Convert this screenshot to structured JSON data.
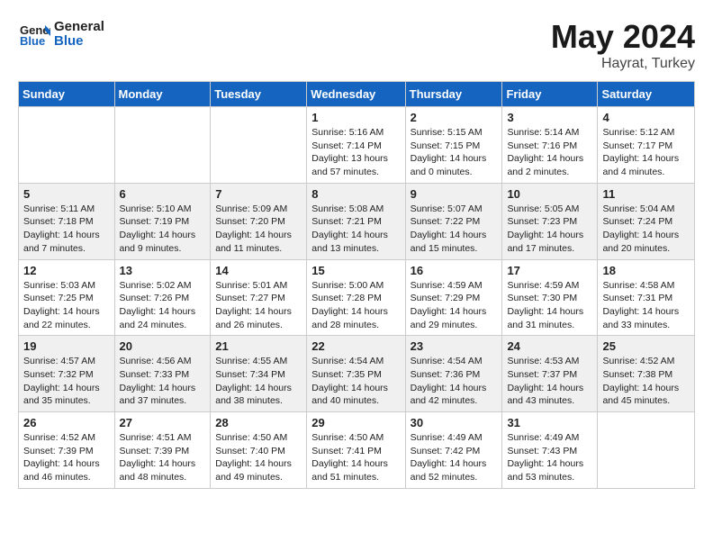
{
  "header": {
    "logo_text_general": "General",
    "logo_text_blue": "Blue",
    "title": "May 2024",
    "subtitle": "Hayrat, Turkey"
  },
  "weekdays": [
    "Sunday",
    "Monday",
    "Tuesday",
    "Wednesday",
    "Thursday",
    "Friday",
    "Saturday"
  ],
  "weeks": [
    [
      {
        "day": "",
        "info": ""
      },
      {
        "day": "",
        "info": ""
      },
      {
        "day": "",
        "info": ""
      },
      {
        "day": "1",
        "info": "Sunrise: 5:16 AM\nSunset: 7:14 PM\nDaylight: 13 hours and 57 minutes."
      },
      {
        "day": "2",
        "info": "Sunrise: 5:15 AM\nSunset: 7:15 PM\nDaylight: 14 hours and 0 minutes."
      },
      {
        "day": "3",
        "info": "Sunrise: 5:14 AM\nSunset: 7:16 PM\nDaylight: 14 hours and 2 minutes."
      },
      {
        "day": "4",
        "info": "Sunrise: 5:12 AM\nSunset: 7:17 PM\nDaylight: 14 hours and 4 minutes."
      }
    ],
    [
      {
        "day": "5",
        "info": "Sunrise: 5:11 AM\nSunset: 7:18 PM\nDaylight: 14 hours and 7 minutes."
      },
      {
        "day": "6",
        "info": "Sunrise: 5:10 AM\nSunset: 7:19 PM\nDaylight: 14 hours and 9 minutes."
      },
      {
        "day": "7",
        "info": "Sunrise: 5:09 AM\nSunset: 7:20 PM\nDaylight: 14 hours and 11 minutes."
      },
      {
        "day": "8",
        "info": "Sunrise: 5:08 AM\nSunset: 7:21 PM\nDaylight: 14 hours and 13 minutes."
      },
      {
        "day": "9",
        "info": "Sunrise: 5:07 AM\nSunset: 7:22 PM\nDaylight: 14 hours and 15 minutes."
      },
      {
        "day": "10",
        "info": "Sunrise: 5:05 AM\nSunset: 7:23 PM\nDaylight: 14 hours and 17 minutes."
      },
      {
        "day": "11",
        "info": "Sunrise: 5:04 AM\nSunset: 7:24 PM\nDaylight: 14 hours and 20 minutes."
      }
    ],
    [
      {
        "day": "12",
        "info": "Sunrise: 5:03 AM\nSunset: 7:25 PM\nDaylight: 14 hours and 22 minutes."
      },
      {
        "day": "13",
        "info": "Sunrise: 5:02 AM\nSunset: 7:26 PM\nDaylight: 14 hours and 24 minutes."
      },
      {
        "day": "14",
        "info": "Sunrise: 5:01 AM\nSunset: 7:27 PM\nDaylight: 14 hours and 26 minutes."
      },
      {
        "day": "15",
        "info": "Sunrise: 5:00 AM\nSunset: 7:28 PM\nDaylight: 14 hours and 28 minutes."
      },
      {
        "day": "16",
        "info": "Sunrise: 4:59 AM\nSunset: 7:29 PM\nDaylight: 14 hours and 29 minutes."
      },
      {
        "day": "17",
        "info": "Sunrise: 4:59 AM\nSunset: 7:30 PM\nDaylight: 14 hours and 31 minutes."
      },
      {
        "day": "18",
        "info": "Sunrise: 4:58 AM\nSunset: 7:31 PM\nDaylight: 14 hours and 33 minutes."
      }
    ],
    [
      {
        "day": "19",
        "info": "Sunrise: 4:57 AM\nSunset: 7:32 PM\nDaylight: 14 hours and 35 minutes."
      },
      {
        "day": "20",
        "info": "Sunrise: 4:56 AM\nSunset: 7:33 PM\nDaylight: 14 hours and 37 minutes."
      },
      {
        "day": "21",
        "info": "Sunrise: 4:55 AM\nSunset: 7:34 PM\nDaylight: 14 hours and 38 minutes."
      },
      {
        "day": "22",
        "info": "Sunrise: 4:54 AM\nSunset: 7:35 PM\nDaylight: 14 hours and 40 minutes."
      },
      {
        "day": "23",
        "info": "Sunrise: 4:54 AM\nSunset: 7:36 PM\nDaylight: 14 hours and 42 minutes."
      },
      {
        "day": "24",
        "info": "Sunrise: 4:53 AM\nSunset: 7:37 PM\nDaylight: 14 hours and 43 minutes."
      },
      {
        "day": "25",
        "info": "Sunrise: 4:52 AM\nSunset: 7:38 PM\nDaylight: 14 hours and 45 minutes."
      }
    ],
    [
      {
        "day": "26",
        "info": "Sunrise: 4:52 AM\nSunset: 7:39 PM\nDaylight: 14 hours and 46 minutes."
      },
      {
        "day": "27",
        "info": "Sunrise: 4:51 AM\nSunset: 7:39 PM\nDaylight: 14 hours and 48 minutes."
      },
      {
        "day": "28",
        "info": "Sunrise: 4:50 AM\nSunset: 7:40 PM\nDaylight: 14 hours and 49 minutes."
      },
      {
        "day": "29",
        "info": "Sunrise: 4:50 AM\nSunset: 7:41 PM\nDaylight: 14 hours and 51 minutes."
      },
      {
        "day": "30",
        "info": "Sunrise: 4:49 AM\nSunset: 7:42 PM\nDaylight: 14 hours and 52 minutes."
      },
      {
        "day": "31",
        "info": "Sunrise: 4:49 AM\nSunset: 7:43 PM\nDaylight: 14 hours and 53 minutes."
      },
      {
        "day": "",
        "info": ""
      }
    ]
  ]
}
